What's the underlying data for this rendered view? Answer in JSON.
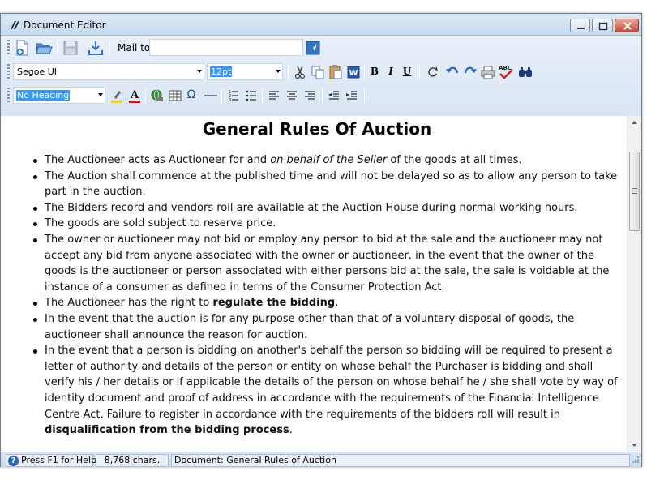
{
  "window": {
    "title": "Document Editor"
  },
  "toolbar1": {
    "mail_to_label": "Mail to",
    "mail_to_value": ""
  },
  "toolbar2": {
    "font_family": "Segoe UI",
    "font_size": "12pt",
    "bold_label": "B",
    "italic_label": "I",
    "underline_label": "U"
  },
  "toolbar3": {
    "heading_style": "No Heading",
    "omega_label": "Ω"
  },
  "document": {
    "title": "General Rules Of Auction",
    "bullets": [
      {
        "parts": [
          {
            "t": "The Auctioneer acts as Auctioneer for and "
          },
          {
            "t": "on behalf of the Seller",
            "i": true
          },
          {
            "t": " of the goods at all times."
          }
        ]
      },
      {
        "parts": [
          {
            "t": "The Auction shall commence at the published time and will not be delayed so as to allow any person to take part in the auction."
          }
        ]
      },
      {
        "parts": [
          {
            "t": "The Bidders record and vendors roll are available at the Auction House during normal working hours."
          }
        ]
      },
      {
        "parts": [
          {
            "t": "The goods are sold subject to reserve price."
          }
        ]
      },
      {
        "parts": [
          {
            "t": "The owner or auctioneer may not bid or employ any person to bid at the sale and the auctioneer may not accept any bid from anyone associated with the owner or auctioneer, in the event that the owner of the goods is the auctioneer or person associated with either persons bid at the sale, the sale is voidable at the instance of a consumer as defined in terms of the Consumer Protection Act."
          }
        ]
      },
      {
        "parts": [
          {
            "t": "The Auctioneer has the right to "
          },
          {
            "t": "regulate the bidding",
            "b": true
          },
          {
            "t": "."
          }
        ]
      },
      {
        "parts": [
          {
            "t": "In the event that the auction is for any purpose other than that of a voluntary disposal of goods, the auctioneer shall announce the reason for auction."
          }
        ]
      },
      {
        "parts": [
          {
            "t": "In the event that a person is bidding on another's behalf the person so bidding will be required to present a letter of authority and details of the person or entity on whose behalf the Purchaser is bidding and shall verify his / her details or if applicable the details of the person on whose behalf he / she shall vote by way of identity document and proof of address in accordance with the requirements of the Financial Intelligence Centre Act. Failure to register in accordance with the requirements of the bidders roll will result in "
          },
          {
            "t": "disqualification from the bidding process",
            "b": true
          },
          {
            "t": "."
          }
        ]
      }
    ]
  },
  "statusbar": {
    "help_text": "Press F1 for Help",
    "char_count": "8,768 chars.",
    "document_label": "Document: General Rules of Auction"
  },
  "colors": {
    "titlebar_top": "#dde9f5",
    "toolbar_bg": "#dfeaf6",
    "close_button": "#c74a35",
    "selection": "#3399ff"
  }
}
